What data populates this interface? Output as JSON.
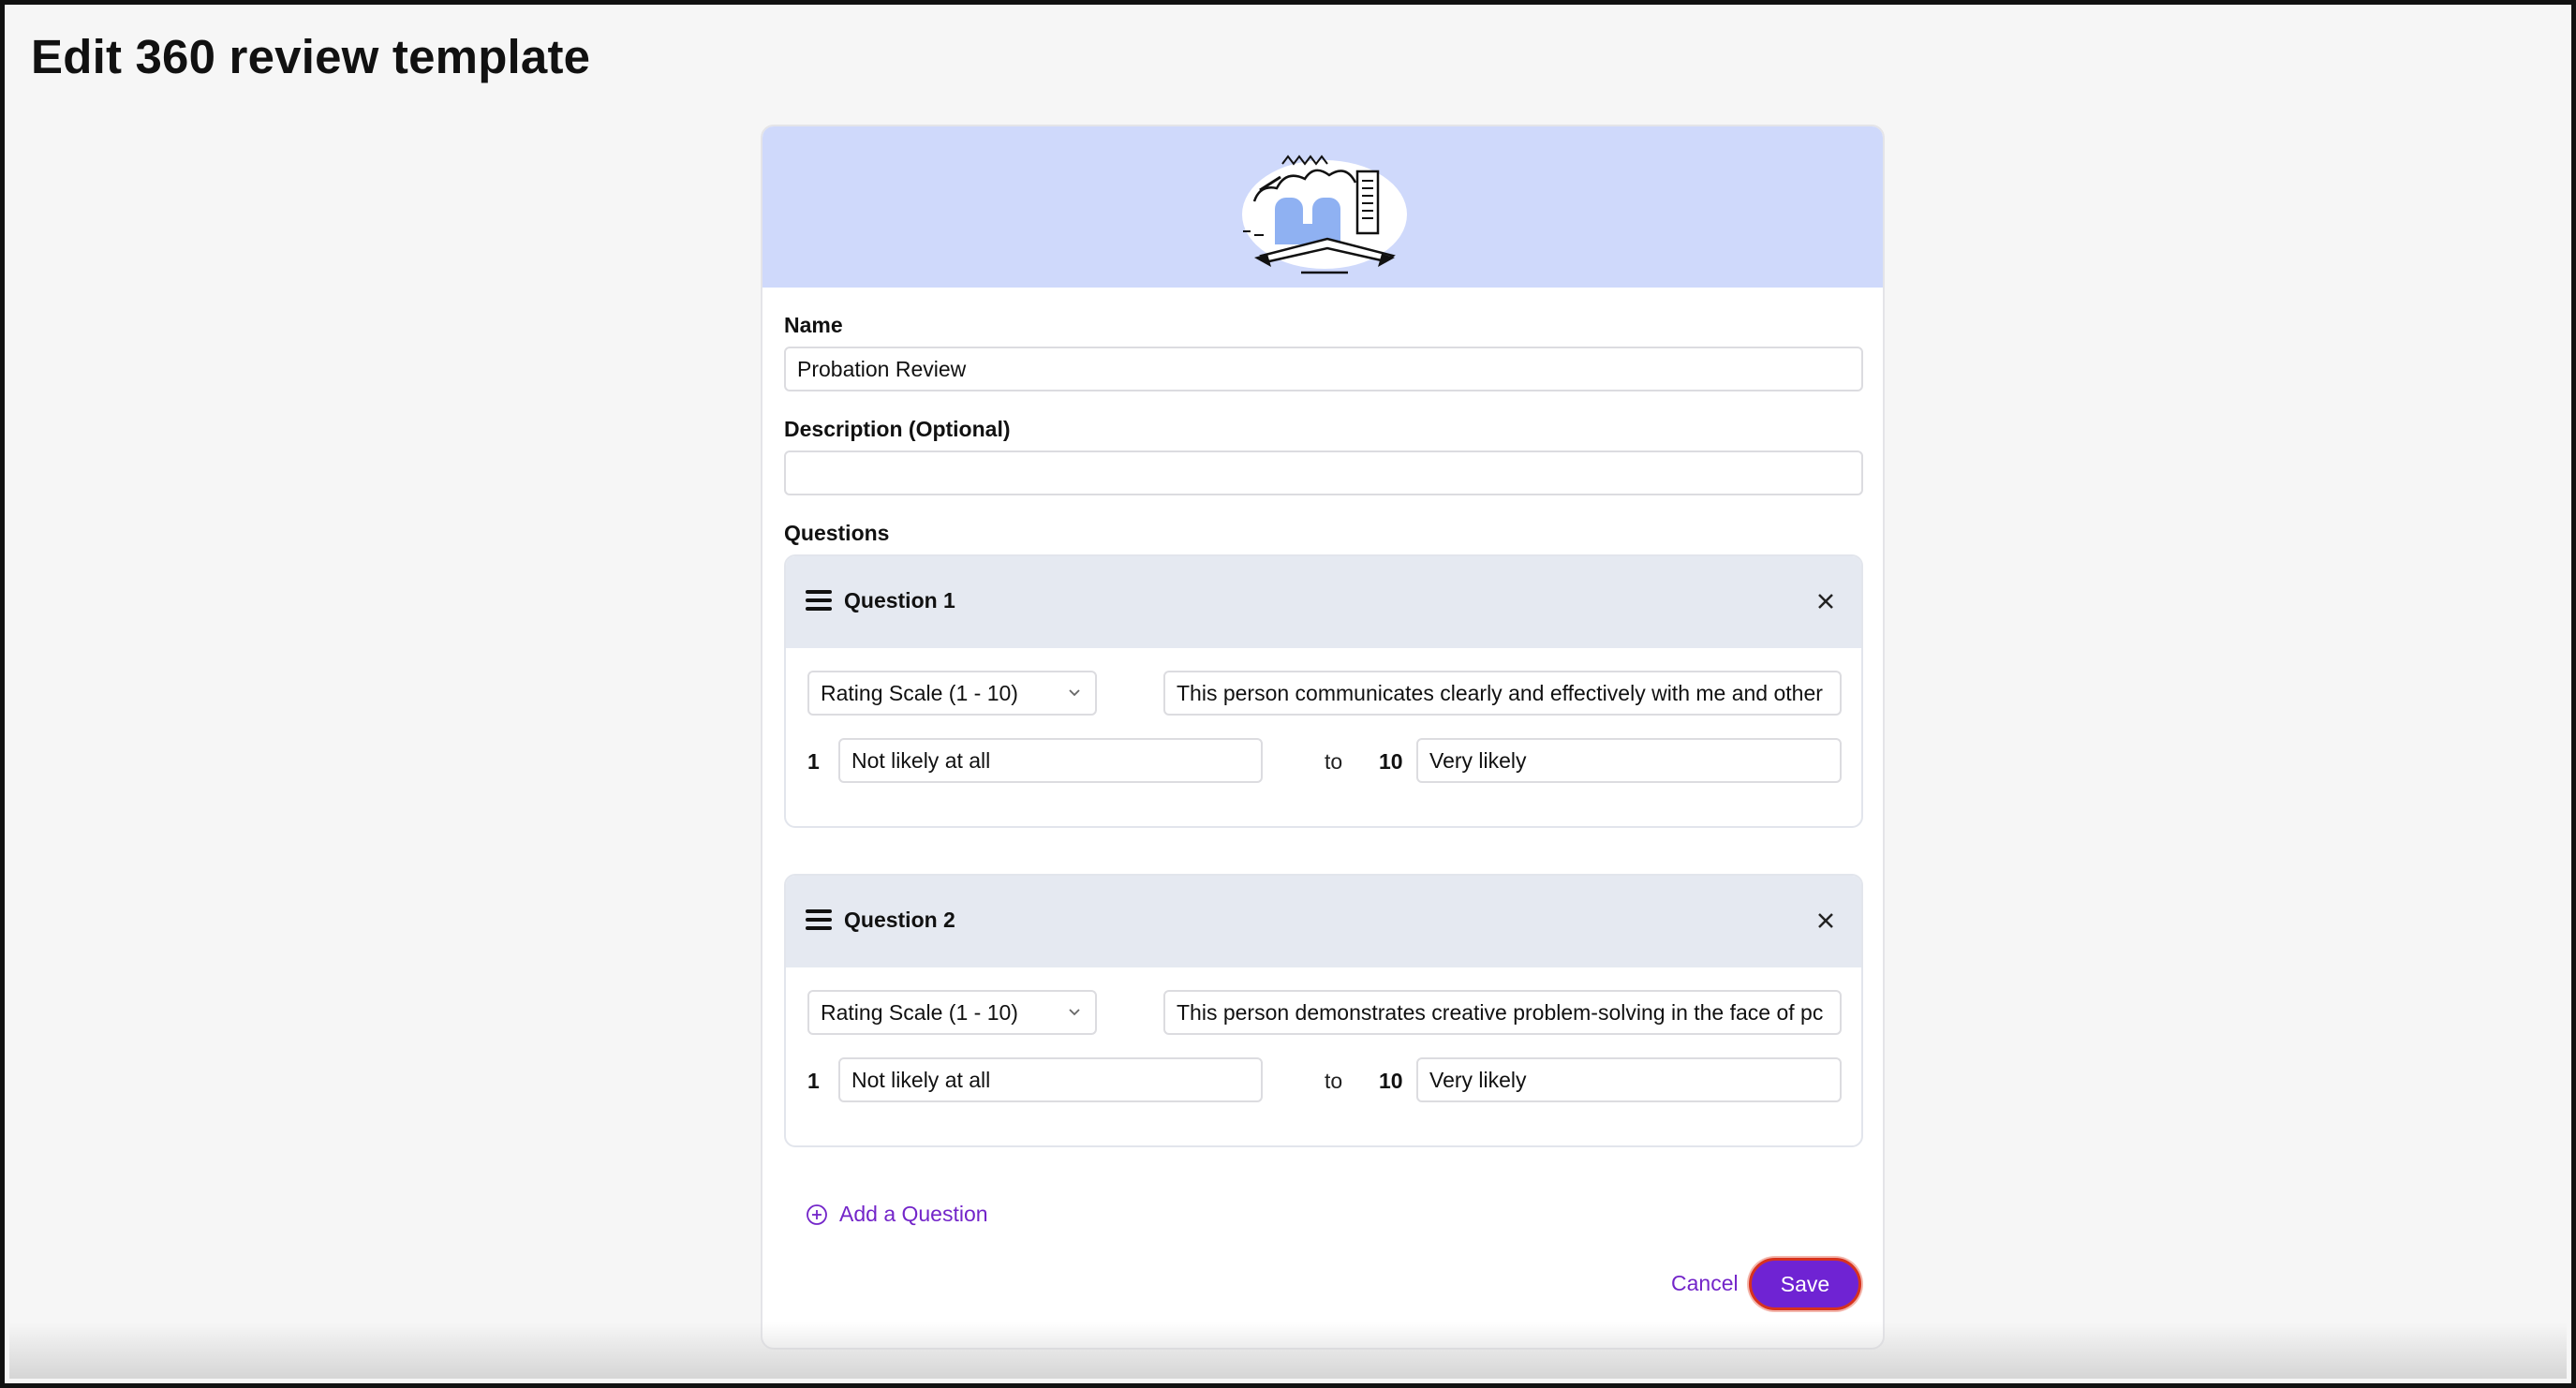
{
  "page": {
    "title": "Edit 360 review template"
  },
  "form": {
    "name_label": "Name",
    "name_value": "Probation Review",
    "description_label": "Description (Optional)",
    "description_value": "",
    "questions_label": "Questions"
  },
  "questions": [
    {
      "title": "Question 1",
      "type": "Rating Scale (1 - 10)",
      "text": "This person communicates clearly and effectively with me and other",
      "min_value": "1",
      "min_label": "Not likely at all",
      "to": "to",
      "max_value": "10",
      "max_label": "Very likely"
    },
    {
      "title": "Question 2",
      "type": "Rating Scale (1 - 10)",
      "text": "This person demonstrates creative problem-solving in the face of pc",
      "min_value": "1",
      "min_label": "Not likely at all",
      "to": "to",
      "max_value": "10",
      "max_label": "Very likely"
    }
  ],
  "actions": {
    "add_question": "Add a Question",
    "cancel": "Cancel",
    "save": "Save"
  },
  "icons": {
    "drag": "hamburger-icon",
    "close": "close-icon",
    "dropdown": "chevron-down-icon",
    "add": "plus-circle-icon"
  },
  "colors": {
    "accent": "#6f23d3",
    "link": "#7325c9",
    "banner": "#cfd9fb",
    "question_header": "#e5e9f1",
    "save_outline": "#d7321e"
  }
}
